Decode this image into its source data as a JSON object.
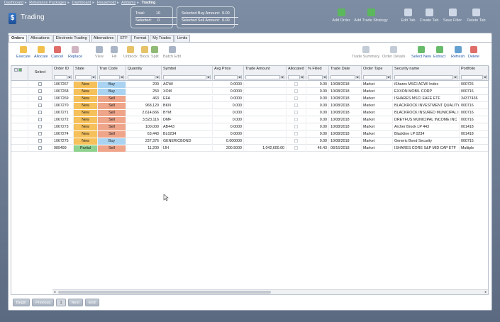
{
  "breadcrumb": [
    "Dashboard",
    "Rebalance Packages",
    "Dashboard",
    "Household",
    "Addams",
    "Trading"
  ],
  "app": {
    "title": "Trading",
    "logo_glyph": "$"
  },
  "summary": {
    "total_label": "Total:",
    "total_value": "10",
    "selected_label": "Selected:",
    "selected_value": "0",
    "buy_label": "Selected Buy Amount:",
    "buy_value": "0.00",
    "sell_label": "Selected Sell Amount:",
    "sell_value": "0.00"
  },
  "toolbar": [
    {
      "label": "Add Order",
      "icon": "add-order-icon",
      "color": "#5cb85c"
    },
    {
      "label": "Add Trade Strategy",
      "icon": "add-strategy-icon",
      "color": "#5cb85c"
    },
    {
      "label": "Edit Tab",
      "icon": "edit-tab-icon",
      "color": "#cfd8e6"
    },
    {
      "label": "Create Tab",
      "icon": "create-tab-icon",
      "color": "#cfd8e6"
    },
    {
      "label": "Save Filter",
      "icon": "save-filter-icon",
      "color": "#cfd8e6"
    },
    {
      "label": "Delete Tab",
      "icon": "delete-tab-icon",
      "color": "#cfd8e6"
    }
  ],
  "tabs": [
    "Orders",
    "Allocations",
    "Electronic Trading",
    "Alternatives",
    "ETF",
    "Format",
    "My Trades",
    "Limits"
  ],
  "actions_left": [
    {
      "label": "Execute",
      "icon": "execute-icon",
      "color": "#f0b62e"
    },
    {
      "label": "Allocate",
      "icon": "allocate-icon",
      "color": "#f0b62e"
    },
    {
      "label": "Cancel",
      "icon": "cancel-icon",
      "color": "#d9534f"
    },
    {
      "label": "Replace",
      "icon": "replace-icon",
      "color": "#c9a8b8"
    },
    {
      "label": "View",
      "icon": "view-icon",
      "color": "#9aa8bc"
    },
    {
      "label": "Fill",
      "icon": "fill-icon",
      "color": "#9aa8bc"
    },
    {
      "label": "Unblock",
      "icon": "unblock-icon",
      "color": "#e2b84d"
    },
    {
      "label": "Block",
      "icon": "block-icon",
      "color": "#e2b84d"
    },
    {
      "label": "Split",
      "icon": "split-icon",
      "color": "#7cae5e"
    },
    {
      "label": "Batch Edit",
      "icon": "batch-edit-icon",
      "color": "#9aa8bc"
    }
  ],
  "actions_right": [
    {
      "label": "Trade Summary",
      "icon": "trade-summary-icon",
      "color": "#b9c3d0"
    },
    {
      "label": "Order Details",
      "icon": "order-details-icon",
      "color": "#b9c3d0"
    },
    {
      "label": "Select New",
      "icon": "select-new-icon",
      "color": "#4caf50"
    },
    {
      "label": "Extract",
      "icon": "extract-icon",
      "color": "#4caf50"
    },
    {
      "label": "Refresh",
      "icon": "refresh-icon",
      "color": "#4a90c8"
    },
    {
      "label": "Delete",
      "icon": "delete-icon",
      "color": "#d9534f"
    }
  ],
  "columns": [
    "",
    "Select",
    "Order ID",
    "State",
    "Tran Code",
    "Quantity",
    "Symbol",
    "Avg Price",
    "Trade Amount",
    "Allocated",
    "% Filled",
    "Trade Date",
    "Order Type",
    "Security name",
    "Portfolio"
  ],
  "rows": [
    {
      "id": "1067267",
      "state": "New",
      "tran": "Buy",
      "qty": "200",
      "sym": "ACWI",
      "avg": "0.0000",
      "amt": "",
      "filled": "0.00",
      "date": "10/08/2018",
      "type": "Market",
      "sec": "iShares MSCI ACWI Index",
      "port": "000726"
    },
    {
      "id": "1067268",
      "state": "New",
      "tran": "Buy",
      "qty": "250",
      "sym": "XOM",
      "avg": "0.0000",
      "amt": "",
      "filled": "0.00",
      "date": "10/08/2018",
      "type": "Market",
      "sec": "EXXON MOBIL CORP",
      "port": "000716"
    },
    {
      "id": "1067269",
      "state": "New",
      "tran": "Sell",
      "qty": "463",
      "sym": "EFA",
      "avg": "0.0000",
      "amt": "",
      "filled": "0.00",
      "date": "10/08/2018",
      "type": "Market",
      "sec": "ISHARES MSCI EAFE ETF",
      "port": "34377436"
    },
    {
      "id": "1067270",
      "state": "New",
      "tran": "Sell",
      "qty": "968,120",
      "sym": "BKN",
      "avg": "0.000",
      "amt": "",
      "filled": "0.00",
      "date": "10/08/2018",
      "type": "Market",
      "sec": "BLACKROCK INVESTMENT QUALITY",
      "port": "000716"
    },
    {
      "id": "1067271",
      "state": "New",
      "tran": "Sell",
      "qty": "2,614,666",
      "sym": "BYM",
      "avg": "0.000",
      "amt": "",
      "filled": "0.00",
      "date": "10/08/2018",
      "type": "Market",
      "sec": "BLACKROCK INSURED MUNICIPAL IN",
      "port": "000716"
    },
    {
      "id": "1067272",
      "state": "New",
      "tran": "Sell",
      "qty": "3,523,116",
      "sym": "DMF",
      "avg": "0.000",
      "amt": "",
      "filled": "0.00",
      "date": "10/08/2018",
      "type": "Market",
      "sec": "DREYFUS MUNICIPAL INCOME INC",
      "port": "000716"
    },
    {
      "id": "1067273",
      "state": "New",
      "tran": "Sell",
      "qty": "100,000",
      "sym": "AB443",
      "avg": "0.0000",
      "amt": "",
      "filled": "0.00",
      "date": "10/08/2018",
      "type": "Market",
      "sec": "Archer Brook LP 443",
      "port": "001418"
    },
    {
      "id": "1067274",
      "state": "New",
      "tran": "Sell",
      "qty": "63,443",
      "sym": "BL0234",
      "avg": "0.0000",
      "amt": "",
      "filled": "0.00",
      "date": "10/08/2018",
      "type": "Market",
      "sec": "Blackline LP 0234",
      "port": "001418"
    },
    {
      "id": "1067275",
      "state": "New",
      "tran": "Buy",
      "qty": "237,376",
      "sym": "GENERICBOND",
      "avg": "0.000000",
      "amt": "",
      "filled": "0.00",
      "date": "10/08/2018",
      "type": "Market",
      "sec": "Generic Bond Security",
      "port": "000715"
    },
    {
      "id": "989499",
      "state": "Partial",
      "tran": "Sell",
      "qty": "11,200",
      "sym": "IJH",
      "avg": "200.5000",
      "amt": "1,042,600.00",
      "filled": "46.43",
      "date": "08/16/2018",
      "type": "Market",
      "sec": "ISHARES CORE S&P MID CAP ETF",
      "port": "Multiple"
    }
  ],
  "pager": {
    "begin": "Begin",
    "previous": "Previous",
    "page": "1",
    "next": "Next",
    "end": "End"
  }
}
